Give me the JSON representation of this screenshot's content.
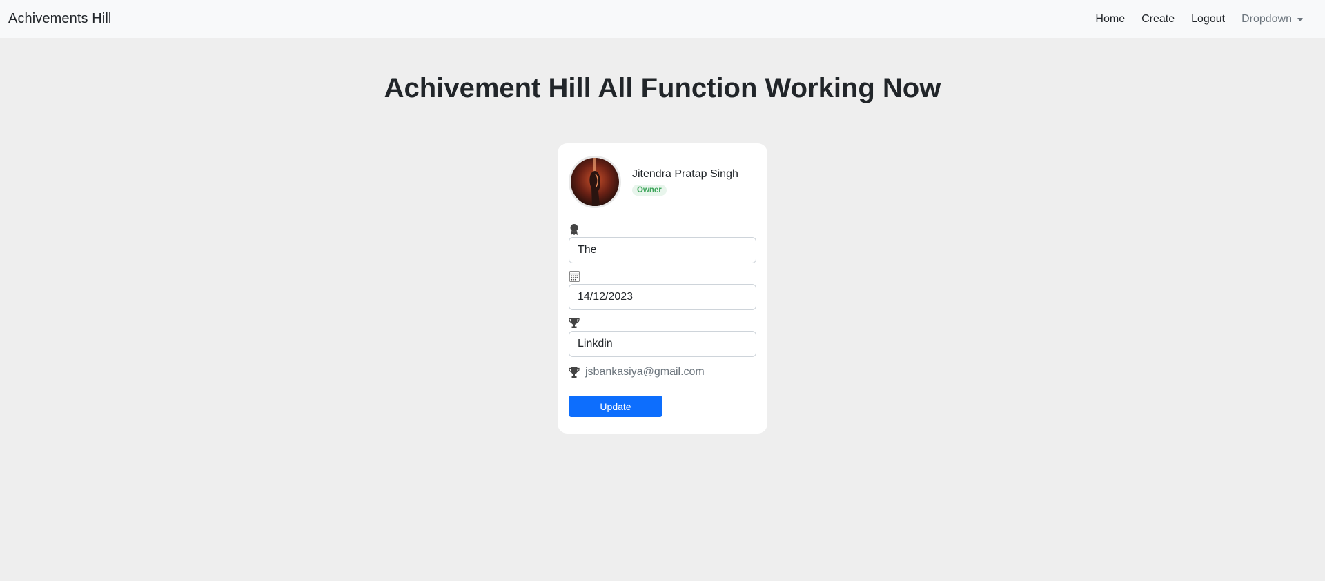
{
  "navbar": {
    "brand": "Achivements Hill",
    "links": {
      "home": "Home",
      "create": "Create",
      "logout": "Logout",
      "dropdown": "Dropdown"
    }
  },
  "page": {
    "title": "Achivement Hill All Function Working Now"
  },
  "card": {
    "profile": {
      "name": "Jitendra Pratap Singh",
      "badge": "Owner"
    },
    "fields": {
      "achievement": "The",
      "date": "14/12/2023",
      "platform": "Linkdin"
    },
    "email": "jsbankasiya@gmail.com",
    "update_label": "Update"
  },
  "colors": {
    "navbar_bg": "#f8f9fa",
    "page_bg": "#eeeeee",
    "primary": "#0d6efd",
    "badge_text": "#3fa65c",
    "badge_bg": "#e8f5ec"
  },
  "icons": {
    "achievement": "award-icon",
    "date": "calendar-icon",
    "platform": "trophy-icon",
    "email": "trophy-icon"
  }
}
